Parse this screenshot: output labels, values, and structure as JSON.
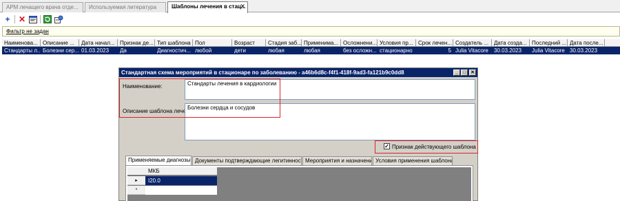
{
  "tabs": [
    {
      "label": "АРМ лечащего  врача  отде..."
    },
    {
      "label": "Используемая литература"
    },
    {
      "label": "Шаблоны лечения в стац..."
    }
  ],
  "tab_close": "✕",
  "filter": {
    "text": "Фильтр не задан"
  },
  "grid": {
    "columns": [
      "Наименова...",
      "Описание ...",
      "Дата начал...",
      "Признак де...",
      "Тип шаблона",
      "Пол",
      "Возраст",
      "Стадия заб...",
      "Применима...",
      "Осложнени...",
      "Условия пр...",
      "Срок лечен...",
      "Создатель ...",
      "Дата созда...",
      "Последний ...",
      "Дата после..."
    ],
    "row": [
      "Стандарты л...",
      "Болезни сер...",
      "01.03.2023",
      "Да",
      "Диагностич...",
      "любой",
      "дети",
      "любая",
      "любая",
      "без осложн...",
      "стационарно",
      "5",
      "Julia Vitacore",
      "30.03.2023",
      "Julia Vitacore",
      "30.03.2023"
    ]
  },
  "dialog": {
    "title": "Стандартная схема мероприятий в стационаре по заболеванию - a46b6d8c-f4f1-418f-9ad3-fa121b9c0dd8",
    "name_label": "Наименование:",
    "name_value": "Стандарты лечения в кардиологии",
    "desc_label": "Описание шаблона лечения:",
    "desc_value": "Болезни сердца и сосудов",
    "active_checkbox_label": "Признак действующего шаблона",
    "active_checked": true,
    "tabs": [
      "Применяемые диагнозы",
      "Документы подтверждающие легитинность",
      "Мероприятия и назначения",
      "Условия применения шаблона"
    ],
    "subgrid": {
      "column": "МКБ",
      "rows": [
        "I20.0"
      ]
    }
  },
  "colors": {
    "selection": "#0a246a",
    "highlight_box": "#d8232a"
  }
}
